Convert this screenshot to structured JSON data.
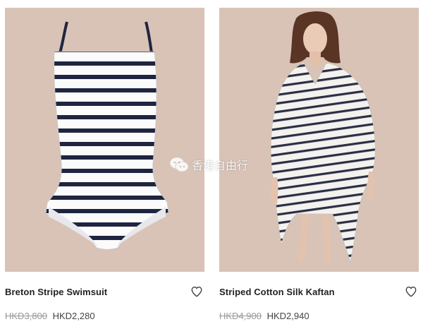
{
  "products": [
    {
      "name": "Breton Stripe Swimsuit",
      "original_price": "HKD3,800",
      "sale_price": "HKD2,280"
    },
    {
      "name": "Striped Cotton Silk Kaftan",
      "original_price": "HKD4,900",
      "sale_price": "HKD2,940"
    }
  ],
  "icons": {
    "wishlist": "heart-outline-icon",
    "watermark": "wechat-icon"
  },
  "watermark": {
    "text": "香港自由行"
  },
  "colors": {
    "photo_background": "#d8c3b6",
    "stripe_navy": "#1f2540",
    "old_price": "#9a9a9a",
    "sale_price": "#444444"
  }
}
